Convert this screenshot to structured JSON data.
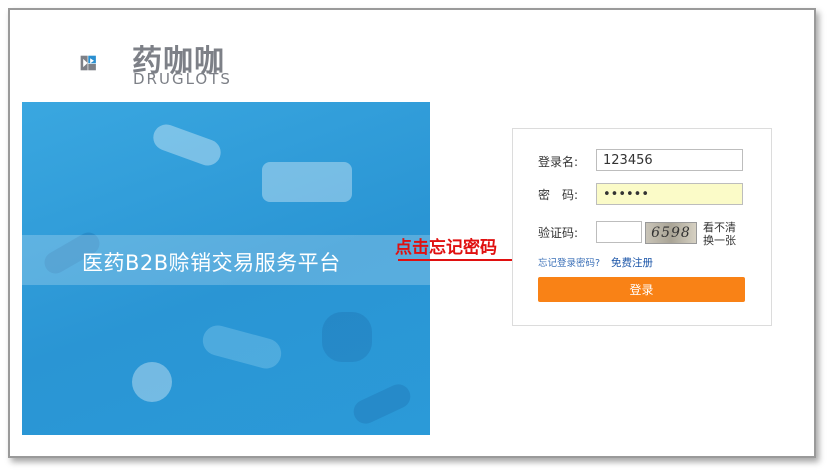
{
  "brand": {
    "name_cn": "药咖咖",
    "name_en": "DRUGLOTS",
    "colors": {
      "logo_gray": "#7d8087",
      "logo_blue": "#2a8fd0"
    }
  },
  "banner": {
    "title": "医药B2B赊销交易服务平台",
    "color": "#2a95d4"
  },
  "login": {
    "username_label": "登录名:",
    "username_value": "123456",
    "password_label": "密　码:",
    "password_value": "••••••",
    "captcha_label": "验证码:",
    "captcha_value": "",
    "captcha_image_text": "6598",
    "refresh_label": "看不清换一张",
    "forgot_link": "忘记登录密码?",
    "register_link": "免费注册",
    "submit_label": "登录",
    "button_color": "#f98216"
  },
  "annotation": {
    "text": "点击忘记密码",
    "color": "#e01010"
  }
}
